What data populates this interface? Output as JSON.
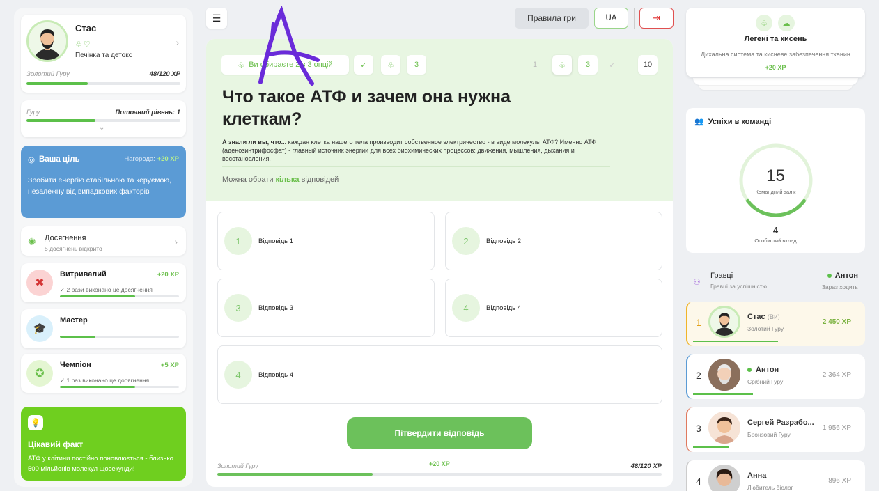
{
  "profile": {
    "name": "Стас",
    "subtitle": "Печінка та детокс",
    "rank": "Золотий Гуру",
    "xp": "48/120 XP",
    "progress": 0.4
  },
  "level": {
    "rank": "Гуру",
    "current_level": "Поточний рівень: 1",
    "progress": 0.45
  },
  "goal": {
    "title": "Ваша ціль",
    "reward_label": "Нагорода:",
    "reward_value": "+20 XP",
    "text": "Зробити енергію стабільною та керуємою, незалежну від випадкових факторів"
  },
  "achievements": {
    "title": "Досягнення",
    "subtitle": "5 досягнень відкрито",
    "items": [
      {
        "title": "Витривалий",
        "xp": "+20 XP",
        "sub": "✓ 2 рази виконано це досягнення",
        "progress": 0.63,
        "color": "#fbd3d3",
        "icon": "hammer-wrench-icon"
      },
      {
        "title": "Мастер",
        "xp": "",
        "sub": "",
        "progress": 0.3,
        "color": "#d9f0fb",
        "icon": "graduation-cap-icon"
      },
      {
        "title": "Чемпіон",
        "xp": "+5 XP",
        "sub": "✓ 1 раз виконано це досягнення",
        "progress": 0.63,
        "color": "#e4f6d2",
        "icon": "medal-icon"
      }
    ]
  },
  "fact": {
    "title": "Цікавий факт",
    "text": "АТФ у клітини постійно поновлюється - близько 500 мільйонів молекул щосекунди!"
  },
  "topbar": {
    "rules": "Правила гри",
    "lang": "UA"
  },
  "question": {
    "status_pill": "Ви обираєте 2 з 3 опцій",
    "count_pill": "3",
    "nav": [
      "1",
      "3",
      "10"
    ],
    "title": "Что такое АТФ и зачем она нужна клеткам?",
    "desc_bold": "А знали ли вы, что...",
    "desc": " каждая клетка нашего тела производит собственное электричество - в виде молекулы АТФ? Именно АТФ (аденозинтрифосфат) - главный источник энергии для всех биохимических процессов: движения, мышления, дыхания и восстановления.",
    "hint_pre": "Можна обрати ",
    "hint_bold": "кілька",
    "hint_post": " відповідей",
    "answers": [
      {
        "num": "1",
        "label": "Відповідь 1"
      },
      {
        "num": "2",
        "label": "Відповідь 2"
      },
      {
        "num": "3",
        "label": "Відповідь 3"
      },
      {
        "num": "4",
        "label": "Відповідь 4"
      },
      {
        "num": "4",
        "label": "Відповідь 4"
      }
    ],
    "submit": "Пітвердити відповідь",
    "footer_rank": "Золотий Гуру",
    "footer_xp_gain": "+20 XP",
    "footer_xp": "48/120 XP",
    "footer_progress": 0.35
  },
  "topic": {
    "title": "Легені та кисень",
    "desc": "Дихальна система та кисневе забезпечення тканин",
    "xp": "+20 XP"
  },
  "team": {
    "title": "Успіхи в команді",
    "score": "15",
    "score_label": "Командний залік",
    "personal": "4",
    "personal_label": "Особистий вклад",
    "progress": 0.3
  },
  "players": {
    "title": "Гравці",
    "subtitle": "Гравці за успішністю",
    "current": "Антон",
    "current_label": "Зараз ходить",
    "rows": [
      {
        "rank": "1",
        "name": "Стас",
        "you": "(Ви)",
        "rank_title": "Золотий Гуру",
        "points": "2 450 XP",
        "accent": "#f0b429",
        "bg": "#fdf8ea",
        "online": false
      },
      {
        "rank": "2",
        "name": "Антон",
        "you": "",
        "rank_title": "Срібний Гуру",
        "points": "2 364 XP",
        "accent": "#5b9bd5",
        "bg": "#ffffff",
        "online": true
      },
      {
        "rank": "3",
        "name": "Сергей Разрабо...",
        "you": "",
        "rank_title": "Бронзовий Гуру",
        "points": "1 956 XP",
        "accent": "#e07a5f",
        "bg": "#ffffff",
        "online": false
      },
      {
        "rank": "4",
        "name": "Анна",
        "you": "",
        "rank_title": "Любитель біолог",
        "points": "896 XP",
        "accent": "#cccccc",
        "bg": "#ffffff",
        "online": false
      }
    ]
  }
}
